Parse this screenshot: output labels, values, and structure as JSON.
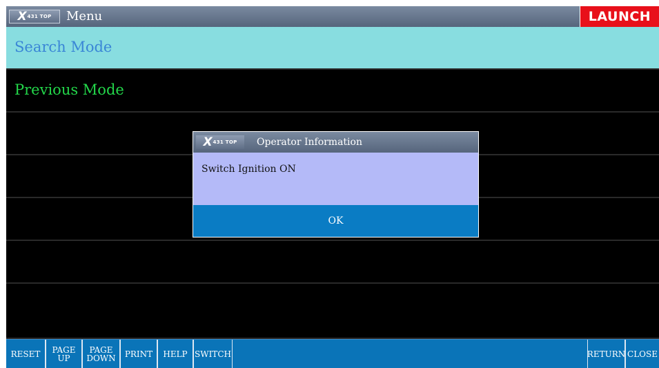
{
  "window": {
    "logo": {
      "mark": "X",
      "sub": "431 TOP"
    },
    "title": "Menu",
    "brand": "LAUNCH"
  },
  "menu": {
    "items": [
      {
        "label": "Search Mode",
        "selected": true
      },
      {
        "label": "Previous Mode",
        "selected": false
      },
      {
        "label": "",
        "selected": false
      },
      {
        "label": "",
        "selected": false
      },
      {
        "label": "",
        "selected": false
      },
      {
        "label": "",
        "selected": false
      },
      {
        "label": "",
        "selected": false
      }
    ]
  },
  "dialog": {
    "logo": {
      "mark": "X",
      "sub": "431 TOP"
    },
    "title": "Operator Information",
    "message": "Switch Ignition ON",
    "ok_label": "OK"
  },
  "toolbar": {
    "reset": "RESET",
    "page_up": {
      "line1": "PAGE",
      "line2": "UP"
    },
    "page_down": {
      "line1": "PAGE",
      "line2": "DOWN"
    },
    "print": "PRINT",
    "help": "HELP",
    "switch": "SWITCH",
    "return": "RETURN",
    "close": "CLOSE"
  },
  "colors": {
    "titlebar": "#56657c",
    "brand_red": "#e8101a",
    "selected_row": "#88dde0",
    "selected_text": "#3a86d6",
    "normal_text": "#23d64a",
    "dialog_body": "#b4baf8",
    "dialog_button": "#0a7cc4",
    "toolbar": "#0a74b8"
  }
}
